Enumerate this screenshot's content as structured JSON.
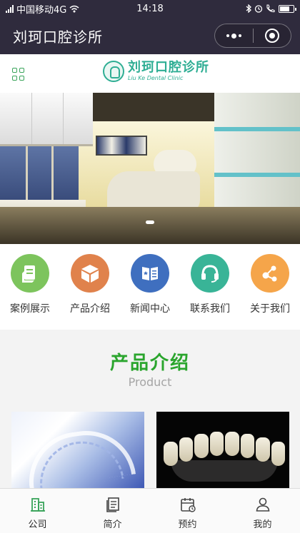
{
  "status_bar": {
    "carrier": "中国移动4G",
    "time": "14:18"
  },
  "title_bar": {
    "title": "刘珂口腔诊所"
  },
  "header": {
    "logo_cn": "刘珂口腔诊所",
    "logo_en": "Liu Ke Dental Clinic"
  },
  "nav": {
    "items": [
      {
        "label": "案例展示",
        "icon": "case-display-icon",
        "color": "#7dc45d"
      },
      {
        "label": "产品介绍",
        "icon": "product-box-icon",
        "color": "#e0824c"
      },
      {
        "label": "新闻中心",
        "icon": "news-icon",
        "color": "#3f6fbf"
      },
      {
        "label": "联系我们",
        "icon": "headset-icon",
        "color": "#39b497"
      },
      {
        "label": "关于我们",
        "icon": "share-nodes-icon",
        "color": "#f5a54a"
      }
    ]
  },
  "product_section": {
    "title": "产品介绍",
    "subtitle": "Product",
    "title_color": "#2aa52d"
  },
  "tabbar": {
    "items": [
      {
        "label": "公司",
        "icon": "building-icon",
        "active": true
      },
      {
        "label": "简介",
        "icon": "document-icon",
        "active": false
      },
      {
        "label": "预约",
        "icon": "calendar-icon",
        "active": false
      },
      {
        "label": "我的",
        "icon": "user-icon",
        "active": false
      }
    ],
    "active_color": "#39a35a"
  }
}
